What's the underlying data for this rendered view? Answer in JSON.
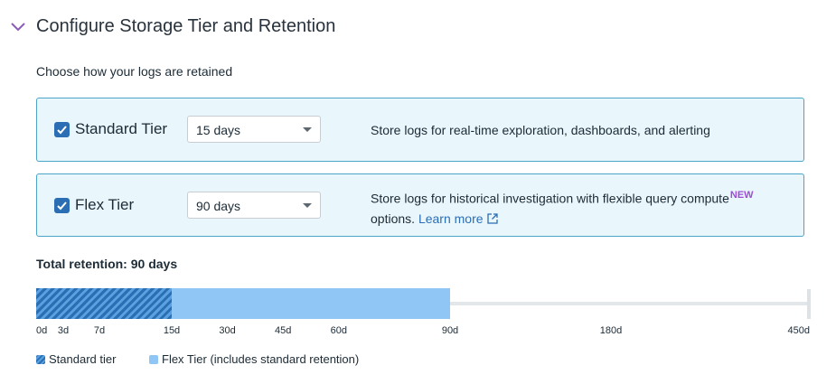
{
  "section": {
    "title": "Configure Storage Tier and Retention",
    "subtitle": "Choose how your logs are retained"
  },
  "tiers": [
    {
      "label": "Standard Tier",
      "checked": true,
      "selected": "15 days",
      "description": "Store logs for real-time exploration, dashboards, and alerting"
    },
    {
      "label": "Flex Tier",
      "checked": true,
      "selected": "90 days",
      "description": "Store logs for historical investigation with flexible query compute",
      "badge": "NEW",
      "description_suffix": "options.",
      "link": "Learn more"
    }
  ],
  "total_retention": "Total retention: 90 days",
  "retention": {
    "max_days": 450,
    "standard_days": 15,
    "flex_days": 90,
    "ticks": [
      {
        "label": "0d",
        "days": 0
      },
      {
        "label": "3d",
        "days": 3
      },
      {
        "label": "7d",
        "days": 7
      },
      {
        "label": "15d",
        "days": 15
      },
      {
        "label": "30d",
        "days": 30
      },
      {
        "label": "45d",
        "days": 45
      },
      {
        "label": "60d",
        "days": 60
      },
      {
        "label": "90d",
        "days": 90
      },
      {
        "label": "180d",
        "days": 180
      },
      {
        "label": "450d",
        "days": 450
      }
    ]
  },
  "legend": {
    "standard": "Standard tier",
    "flex": "Flex Tier (includes standard retention)"
  },
  "colors": {
    "accent": "#2b6eb4",
    "card_background": "#e9f6fb",
    "card_border": "#4aa5c9",
    "flex_fill": "#8fc6f5",
    "badge": "#9c4fd5"
  },
  "icons": {
    "collapse": "chevron-down-icon",
    "checkbox": "checkmark-icon",
    "dropdown": "caret-down-icon",
    "external": "external-link-icon"
  }
}
